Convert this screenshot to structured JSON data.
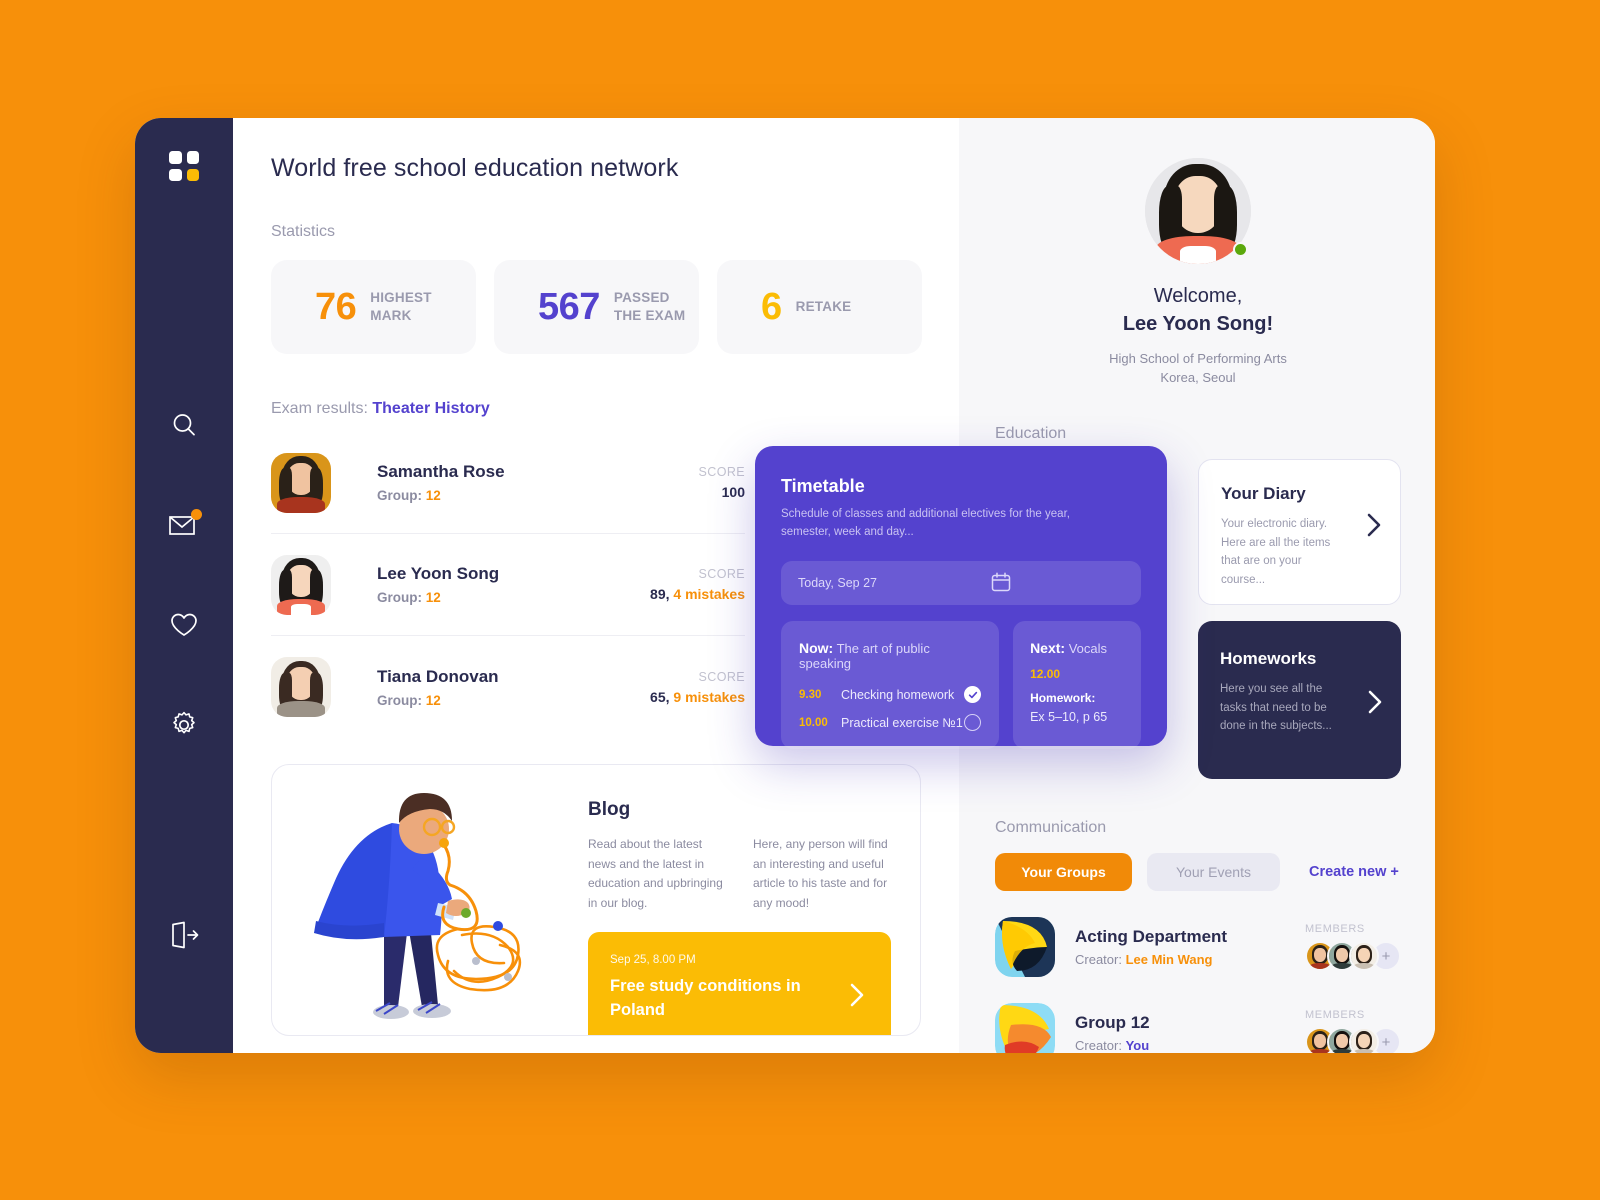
{
  "sidebar": {
    "logo": "grid-logo",
    "items": [
      {
        "name": "search",
        "icon": "search-icon"
      },
      {
        "name": "messages",
        "icon": "mail-icon",
        "badge": true
      },
      {
        "name": "favorites",
        "icon": "heart-icon"
      },
      {
        "name": "settings",
        "icon": "gear-icon"
      },
      {
        "name": "logout",
        "icon": "logout-icon"
      }
    ]
  },
  "header": {
    "title": "World free school education network"
  },
  "statistics": {
    "label": "Statistics",
    "cards": [
      {
        "value": "76",
        "label_line1": "HIGHEST",
        "label_line2": "MARK",
        "color": "#F7900A"
      },
      {
        "value": "567",
        "label_line1": "PASSED",
        "label_line2": "THE EXAM",
        "color": "#5442CE"
      },
      {
        "value": "6",
        "label_line1": "RETAKE",
        "label_line2": "",
        "color": "#FBBC05"
      }
    ]
  },
  "exam": {
    "heading_prefix": "Exam results:",
    "subject": "Theater History",
    "score_label": "SCORE",
    "group_label": "Group:",
    "rows": [
      {
        "name": "Samantha Rose",
        "group": "12",
        "score": "100",
        "mistakes": ""
      },
      {
        "name": "Lee Yoon Song",
        "group": "12",
        "score": "89,",
        "mistakes": "4 mistakes"
      },
      {
        "name": "Tiana Donovan",
        "group": "12",
        "score": "65,",
        "mistakes": "9 mistakes"
      }
    ]
  },
  "blog": {
    "title": "Blog",
    "col1": "Read about the latest news and the latest in education and upbringing in our blog.",
    "col2": "Here, any person will find an interesting and useful article to his taste and for any mood!",
    "cta": {
      "date": "Sep 25, 8.00 PM",
      "headline": "Free study conditions in Poland"
    }
  },
  "profile": {
    "welcome": "Welcome,",
    "name": "Lee Yoon Song!",
    "school_line1": "High School of Performing Arts",
    "school_line2": "Korea, Seoul",
    "status": "online"
  },
  "education": {
    "label": "Education",
    "diary": {
      "title": "Your Diary",
      "text": "Your electronic diary. Here are all the items that are on your course..."
    },
    "homeworks": {
      "title": "Homeworks",
      "text": "Here you see all the tasks that need to be done in the subjects..."
    }
  },
  "timetable": {
    "title": "Timetable",
    "subtitle": "Schedule of classes and additional electives for the year, semester, week and day...",
    "date_value": "Today, Sep 27",
    "now": {
      "label": "Now:",
      "subject": "The art of public speaking",
      "items": [
        {
          "time": "9.30",
          "task": "Checking homework",
          "done": true
        },
        {
          "time": "10.00",
          "task": "Practical exercise №1",
          "done": false
        }
      ]
    },
    "next": {
      "label": "Next:",
      "subject": "Vocals",
      "time": "12.00",
      "homework_label": "Homework:",
      "homework_value": "Ex 5–10, p 65"
    }
  },
  "communication": {
    "label": "Communication",
    "tab_groups": "Your Groups",
    "tab_events": "Your Events",
    "create_new": "Create new +",
    "members_label": "MEMBERS",
    "members_more": "+",
    "groups": [
      {
        "name": "Acting Department",
        "creator_label": "Creator:",
        "creator": "Lee Min Wang",
        "creator_is_you": false
      },
      {
        "name": "Group 12",
        "creator_label": "Creator:",
        "creator": "You",
        "creator_is_you": true
      }
    ]
  },
  "colors": {
    "page_bg": "#F7900A",
    "rail": "#2A2B4F",
    "accent_violet": "#5442CE",
    "accent_orange": "#F7900A",
    "accent_yellow": "#FBBC05",
    "panel_bg": "#F7F7F9"
  }
}
